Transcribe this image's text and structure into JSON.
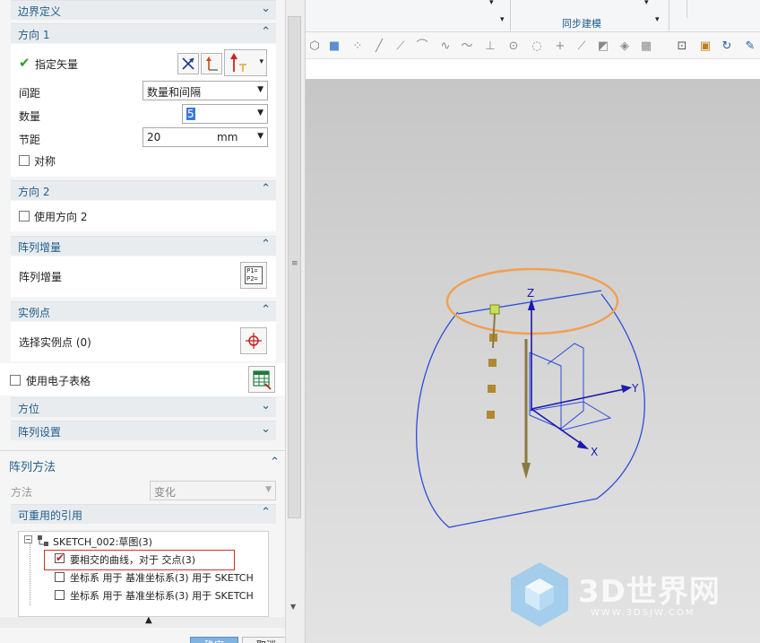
{
  "dialog": {
    "boundary_section": "边界定义",
    "direction1": {
      "title": "方向 1",
      "vector_label": "指定矢量",
      "spacing_label": "间距",
      "spacing_value": "数量和间隔",
      "count_label": "数量",
      "count_value": "5",
      "pitch_label": "节距",
      "pitch_value": "20",
      "pitch_unit": "mm",
      "symmetric_label": "对称"
    },
    "direction2": {
      "title": "方向 2",
      "use_label": "使用方向 2"
    },
    "increment": {
      "title": "阵列增量",
      "label": "阵列增量",
      "icon_text_1": "P1=",
      "icon_text_2": "P2="
    },
    "instance": {
      "title": "实例点",
      "label": "选择实例点 (0)"
    },
    "spreadsheet_label": "使用电子表格",
    "orientation_title": "方位",
    "pattern_settings_title": "阵列设置",
    "method": {
      "title": "阵列方法",
      "label": "方法",
      "value": "变化"
    },
    "reuse": {
      "title": "可重用的引用",
      "tree_root": "SKETCH_002:草图(3)",
      "items": [
        {
          "label": "要相交的曲线，对于 交点(3)",
          "checked": true
        },
        {
          "label": "坐标系  用于  基准坐标系(3)  用于  SKETCH",
          "checked": false
        },
        {
          "label": "坐标系  用于  基准坐标系(3)  用于  SKETCH",
          "checked": false
        }
      ]
    },
    "ok_label": "确定",
    "cancel_label": "取消"
  },
  "ribbon": {
    "group_label": "同步建模"
  },
  "viewport": {
    "axis_x": "X",
    "axis_y": "Y",
    "axis_z": "Z",
    "watermark_title": "3D世界网",
    "watermark_url": "WWW.3DSJW.COM"
  },
  "colors": {
    "accent": "#1f5d8c",
    "sketch_blue": "#2a4dd9",
    "highlight_orange": "#f0a050",
    "check_green": "#2e9e2e",
    "select_red": "#d03030"
  }
}
